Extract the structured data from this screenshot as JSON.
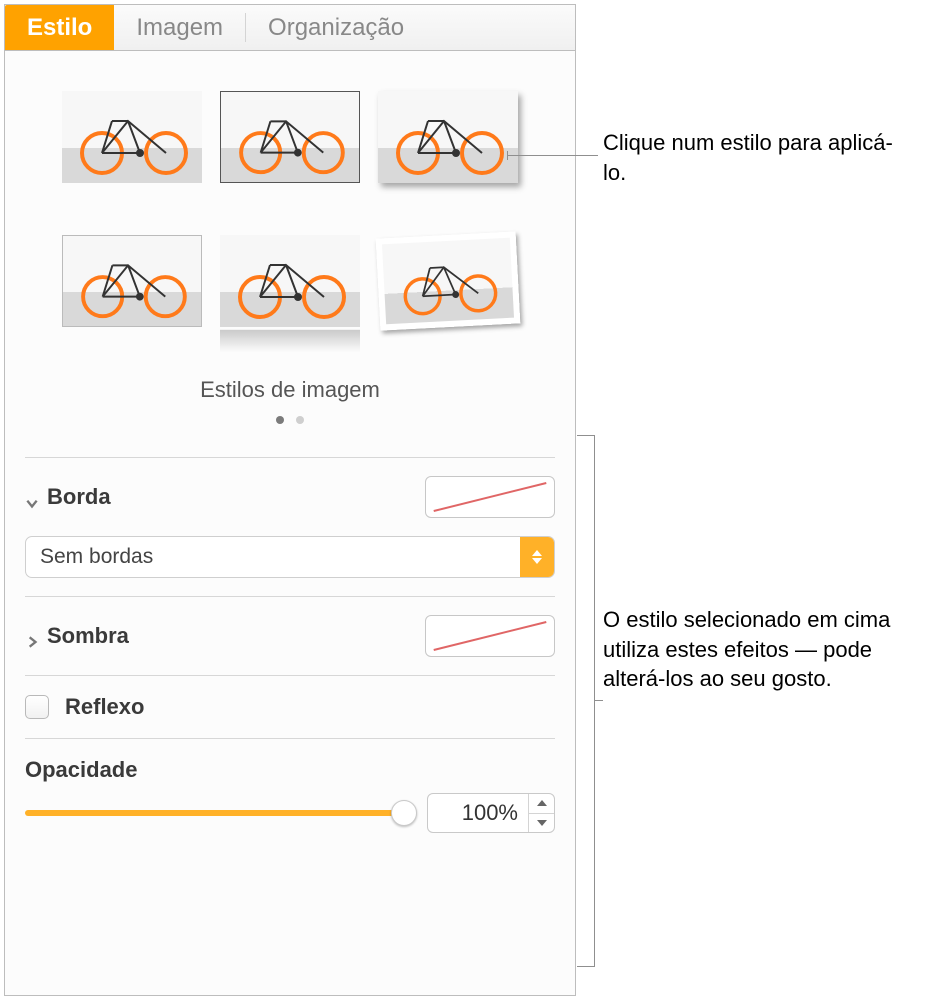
{
  "tabs": {
    "style": "Estilo",
    "image": "Imagem",
    "arrange": "Organização"
  },
  "styles": {
    "heading": "Estilos de imagem"
  },
  "border": {
    "label": "Borda",
    "dropdown": "Sem bordas"
  },
  "shadow": {
    "label": "Sombra"
  },
  "reflection": {
    "label": "Reflexo"
  },
  "opacity": {
    "label": "Opacidade",
    "value": "100%"
  },
  "callouts": {
    "c1": "Clique num estilo para aplicá-lo.",
    "c2": "O estilo selecionado em cima utiliza estes efeitos — pode alterá-los ao seu gosto."
  }
}
